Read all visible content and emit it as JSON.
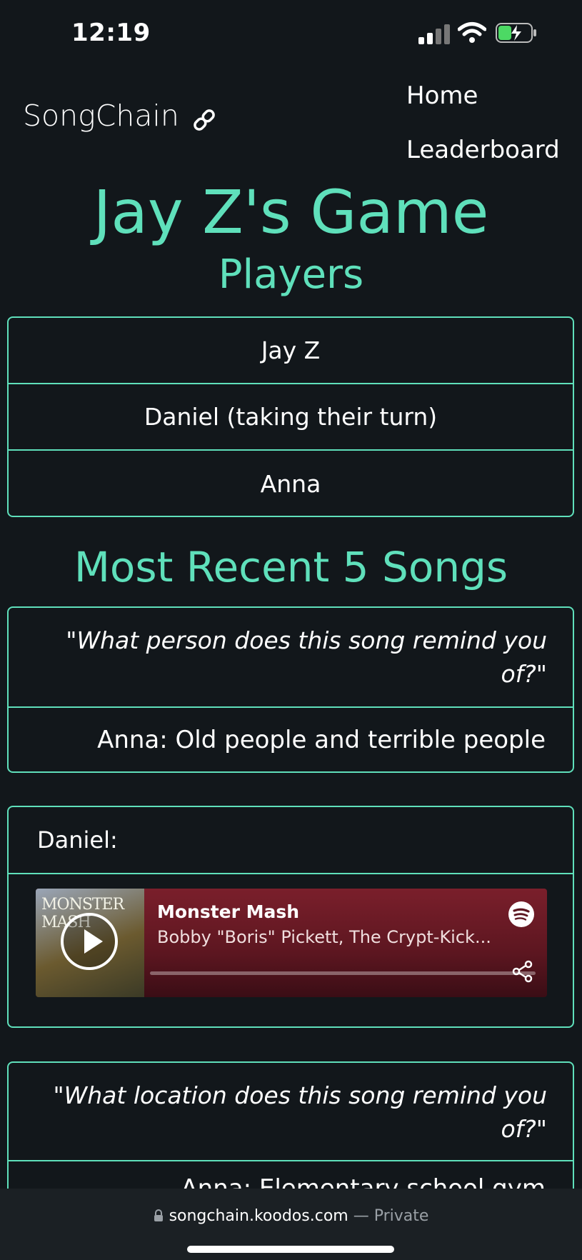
{
  "status_bar": {
    "time": "12:19"
  },
  "header": {
    "brand": "SongChain",
    "nav": [
      "Home",
      "Leaderboard"
    ]
  },
  "page_title": "Jay Z's Game",
  "players": {
    "heading": "Players",
    "items": [
      "Jay Z",
      "Daniel (taking their turn)",
      "Anna"
    ]
  },
  "recent": {
    "heading": "Most Recent 5 Songs",
    "card1": {
      "question": "\"What person does this song remind you of?\"",
      "answer": "Anna: Old people and terrible people"
    },
    "card2": {
      "poster": "Daniel:",
      "track": {
        "art_title": "MONSTER MASH",
        "title": "Monster Mash",
        "artist": "Bobby \"Boris\" Pickett, The Crypt-Kick..."
      }
    },
    "card3": {
      "question": "\"What location does this song remind you of?\"",
      "answer": "Anna: Elementary school gym"
    }
  },
  "browser": {
    "url": "songchain.koodos.com",
    "separator": "—",
    "mode": "Private"
  },
  "colors": {
    "accent": "#5fe0bb",
    "background": "#12171b"
  }
}
